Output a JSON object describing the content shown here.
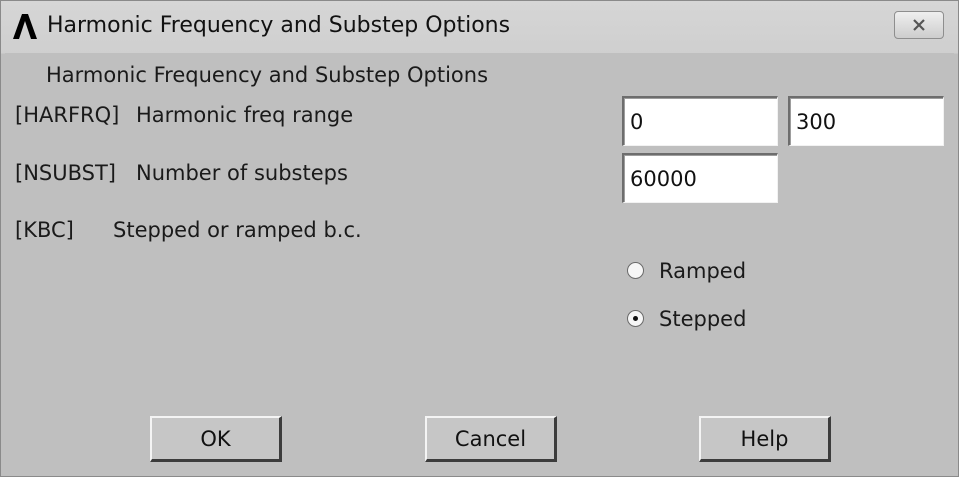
{
  "window": {
    "title": "Harmonic Frequency and Substep Options"
  },
  "dialog": {
    "heading": "Harmonic Frequency and Substep Options",
    "harfrq": {
      "command": "[HARFRQ]",
      "label": "Harmonic freq range",
      "start_value": "0",
      "end_value": "300"
    },
    "nsubst": {
      "command": "[NSUBST]",
      "label": "Number of substeps",
      "value": "60000"
    },
    "kbc": {
      "command": "[KBC]",
      "label": "Stepped or ramped b.c.",
      "options": [
        {
          "label": "Ramped",
          "selected": false
        },
        {
          "label": "Stepped",
          "selected": true
        }
      ]
    },
    "buttons": {
      "ok": "OK",
      "cancel": "Cancel",
      "help": "Help"
    }
  },
  "icons": {
    "app_logo": "ansys-logo-icon",
    "close": "close-icon"
  }
}
